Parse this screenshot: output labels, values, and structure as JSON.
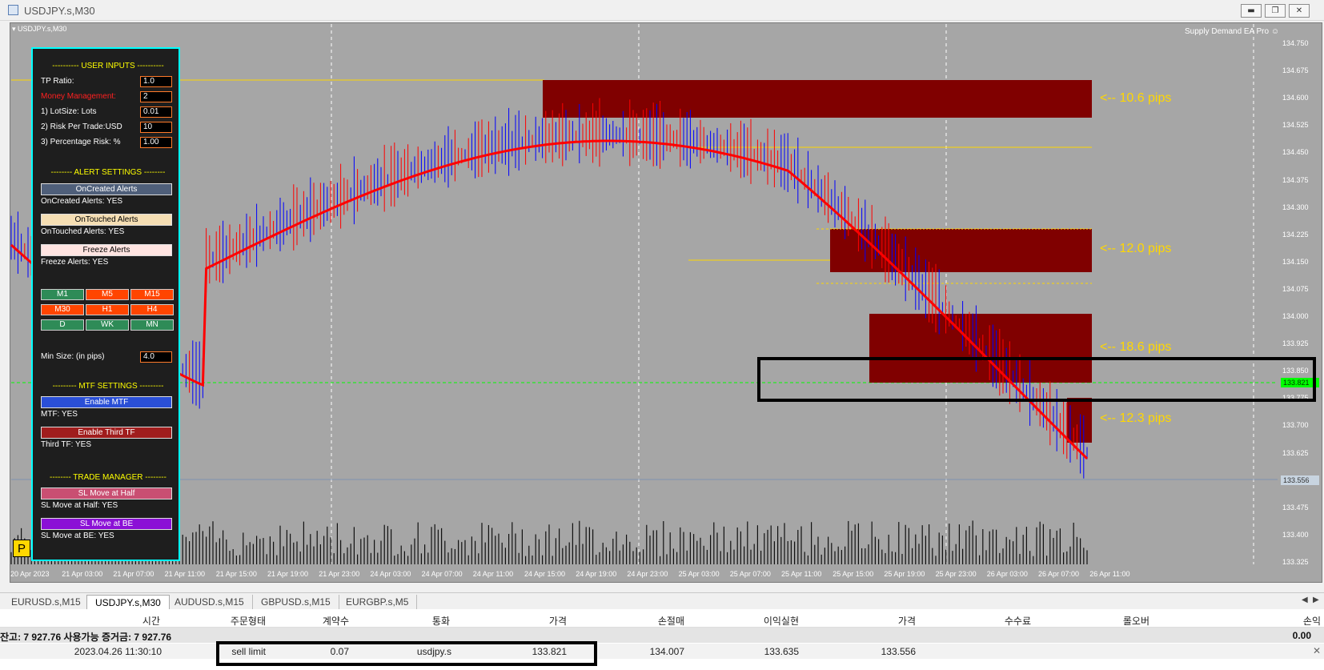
{
  "window": {
    "title": "USDJPY.s,M30",
    "min_icon": "minimize-icon",
    "restore_icon": "restore-icon",
    "close_icon": "close-icon"
  },
  "chart": {
    "symbol_label": "USDJPY.s,M30",
    "ea_label": "Supply Demand EA Pro",
    "ea_icon": "smiley-icon",
    "background": "#a6a6a6",
    "bull_color": "#ff0000",
    "bear_color": "#0000ff",
    "ma_color": "#ff0000",
    "zone_color": "#800000",
    "level_line_color": "#ffd700",
    "pips_labels": [
      "<-- 10.6 pips",
      "<-- 12.0 pips",
      "<-- 18.6 pips",
      "<-- 12.3 pips"
    ],
    "price_ticks": [
      "134.750",
      "134.675",
      "134.600",
      "134.525",
      "134.450",
      "134.375",
      "134.300",
      "134.225",
      "134.150",
      "134.075",
      "134.000",
      "133.925",
      "133.850",
      "133.775",
      "133.700",
      "133.625",
      "133.550",
      "133.475",
      "133.400",
      "133.325"
    ],
    "bid_tag": "133.821",
    "last_tag": "133.556",
    "time_ticks": [
      "20 Apr 2023",
      "21 Apr 03:00",
      "21 Apr 07:00",
      "21 Apr 11:00",
      "21 Apr 15:00",
      "21 Apr 19:00",
      "21 Apr 23:00",
      "24 Apr 03:00",
      "24 Apr 07:00",
      "24 Apr 11:00",
      "24 Apr 15:00",
      "24 Apr 19:00",
      "24 Apr 23:00",
      "25 Apr 03:00",
      "25 Apr 07:00",
      "25 Apr 11:00",
      "25 Apr 15:00",
      "25 Apr 19:00",
      "25 Apr 23:00",
      "26 Apr 03:00",
      "26 Apr 07:00",
      "26 Apr 11:00"
    ],
    "p_button": "P"
  },
  "panel": {
    "user_inputs_title": "---------- USER INPUTS ----------",
    "tp_ratio_label": "TP Ratio:",
    "tp_ratio_value": "1.0",
    "money_mgmt_label": "Money Management:",
    "money_mgmt_value": "2",
    "lotsize_label": "1) LotSize: Lots",
    "lotsize_value": "0.01",
    "risk_label": "2) Risk Per Trade:USD",
    "risk_value": "10",
    "pct_label": "3) Percentage Risk: %",
    "pct_value": "1.00",
    "alert_title": "-------- ALERT SETTINGS --------",
    "oncreated_btn": "OnCreated Alerts",
    "oncreated_status": "OnCreated Alerts: YES",
    "ontouched_btn": "OnTouched Alerts",
    "ontouched_status": "OnTouched Alerts: YES",
    "freeze_btn": "Freeze Alerts",
    "freeze_status": "Freeze Alerts: YES",
    "timeframes": [
      "M1",
      "M5",
      "M15",
      "M30",
      "H1",
      "H4",
      "D",
      "WK",
      "MN"
    ],
    "min_size_label": "Min Size: (in pips)",
    "min_size_value": "4.0",
    "mtf_title": "--------- MTF SETTINGS ---------",
    "enable_mtf_btn": "Enable MTF",
    "mtf_status": "MTF: YES",
    "third_tf_btn": "Enable Third TF",
    "third_tf_status": "Third TF: YES",
    "trade_title": "-------- TRADE MANAGER --------",
    "sl_half_btn": "SL Move at Half",
    "sl_half_status": "SL Move at Half: YES",
    "sl_be_btn": "SL Move at BE",
    "sl_be_status": "SL Move at BE: YES"
  },
  "tabs": [
    "EURUSD.s,M15",
    "USDJPY.s,M30",
    "AUDUSD.s,M15",
    "GBPUSD.s,M15",
    "EURGBP.s,M5"
  ],
  "active_tab": 1,
  "terminal": {
    "headers": [
      "시간",
      "주문형태",
      "계약수",
      "통화",
      "가격",
      "손절매",
      "이익실현",
      "가격",
      "수수료",
      "롤오버",
      "손익"
    ],
    "balance_text": "잔고: 7 927.76  사용가능 증거금: 7 927.76",
    "balance_pl": "0.00",
    "order": {
      "time": "2023.04.26 11:30:10",
      "type": "sell limit",
      "volume": "0.07",
      "symbol": "usdjpy.s",
      "price": "133.821",
      "sl": "134.007",
      "tp": "133.635",
      "current": "133.556"
    }
  }
}
